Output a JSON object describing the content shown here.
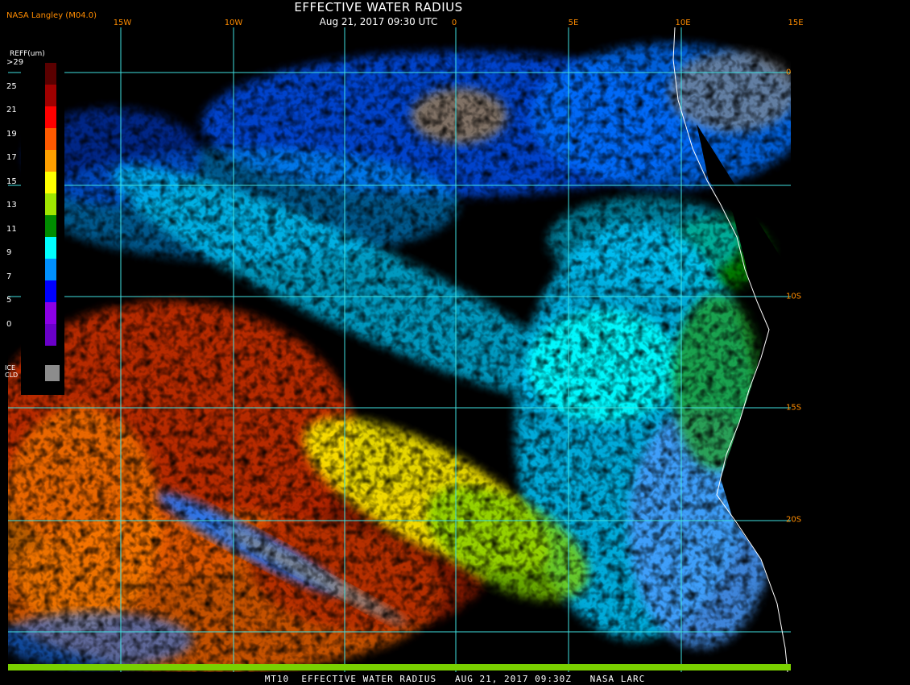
{
  "header": {
    "title": "EFFECTIVE WATER RADIUS",
    "subtitle": "Aug 21, 2017 09:30 UTC",
    "credit": "NASA Langley (M04.0)"
  },
  "footer": {
    "text": "MT10  EFFECTIVE WATER RADIUS   AUG 21, 2017 09:30Z   NASA LARC"
  },
  "legend": {
    "title": "REFF(um)",
    "labels": [
      ">29",
      "25",
      "21",
      "19",
      "17",
      "15",
      "13",
      "11",
      "9",
      "7",
      "5",
      "0"
    ],
    "colors": [
      "#5a0000",
      "#a00000",
      "#ff0000",
      "#ff5a00",
      "#ffa000",
      "#ffff00",
      "#a0e600",
      "#008c00",
      "#00ffff",
      "#0090ff",
      "#0000ff",
      "#8c00e6",
      "#6a00c8"
    ],
    "ice_label": [
      "ICE",
      "CLD"
    ],
    "ice_color": "#8c8c8c"
  },
  "map": {
    "lon_labels": [
      "15W",
      "10W",
      "0",
      "5E",
      "10E",
      "15E"
    ],
    "lat_labels": [
      "0",
      "10S",
      "15S",
      "20S"
    ],
    "grid_color": "#40e0e0",
    "coast_color": "#ffffff"
  }
}
